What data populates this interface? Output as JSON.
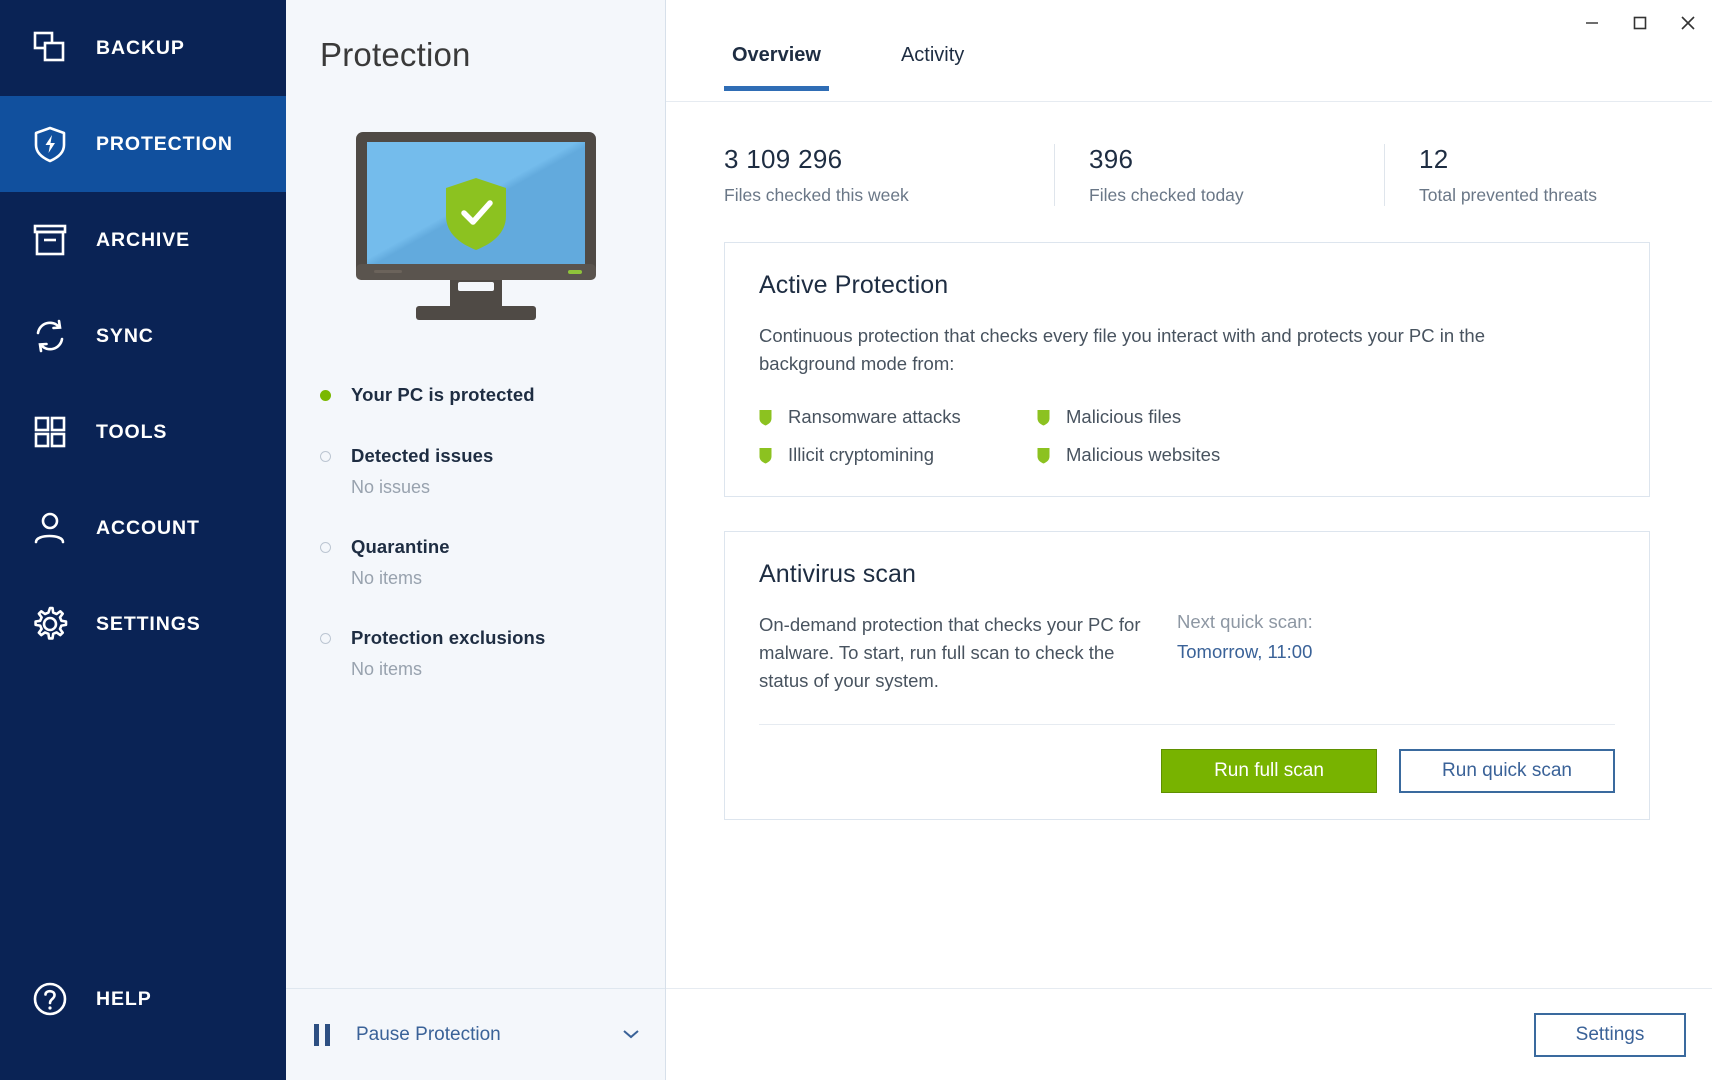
{
  "sidebar": {
    "items": [
      {
        "label": "BACKUP",
        "icon": "copy-icon",
        "active": false
      },
      {
        "label": "PROTECTION",
        "icon": "shield-bolt-icon",
        "active": true
      },
      {
        "label": "ARCHIVE",
        "icon": "archive-box-icon",
        "active": false
      },
      {
        "label": "SYNC",
        "icon": "sync-refresh-icon",
        "active": false
      },
      {
        "label": "TOOLS",
        "icon": "grid-squares-icon",
        "active": false
      },
      {
        "label": "ACCOUNT",
        "icon": "person-icon",
        "active": false
      },
      {
        "label": "SETTINGS",
        "icon": "gear-icon",
        "active": false
      }
    ],
    "help": {
      "label": "HELP",
      "icon": "question-circle-icon"
    }
  },
  "middle": {
    "title": "Protection",
    "illustration": "monitor-with-green-shield-check",
    "status_items": [
      {
        "main": "Your PC is protected",
        "sub": "",
        "dot": "green"
      },
      {
        "main": "Detected issues",
        "sub": "No issues",
        "dot": "hollow"
      },
      {
        "main": "Quarantine",
        "sub": "No items",
        "dot": "hollow"
      },
      {
        "main": "Protection exclusions",
        "sub": "No items",
        "dot": "hollow"
      }
    ],
    "pause": {
      "label": "Pause Protection",
      "icon": "pause-icon",
      "chevron": "⌄"
    }
  },
  "window_controls": {
    "minimize": "minimize-icon",
    "maximize": "maximize-icon",
    "close": "close-icon"
  },
  "tabs": [
    {
      "label": "Overview",
      "active": true
    },
    {
      "label": "Activity",
      "active": false
    }
  ],
  "stats": [
    {
      "value": "3 109 296",
      "label": "Files checked this week"
    },
    {
      "value": "396",
      "label": "Files checked today"
    },
    {
      "value": "12",
      "label": "Total prevented threats"
    }
  ],
  "active_protection": {
    "title": "Active Protection",
    "description": "Continuous protection that checks every file you interact with and protects your PC in the background mode from:",
    "bullets": [
      "Ransomware attacks",
      "Malicious files",
      "Illicit cryptomining",
      "Malicious websites"
    ]
  },
  "antivirus_scan": {
    "title": "Antivirus scan",
    "description": "On-demand protection that checks your PC for malware. To start, run full scan to check the status of your system.",
    "next_scan_label": "Next quick scan:",
    "next_scan_value": "Tomorrow, 11:00",
    "run_full_label": "Run full scan",
    "run_quick_label": "Run quick scan"
  },
  "footer": {
    "settings_label": "Settings"
  },
  "colors": {
    "sidebar_bg": "#0a2355",
    "sidebar_active": "#11509e",
    "accent_blue": "#2f6db5",
    "link_blue": "#3a6298",
    "green": "#78b300",
    "status_green": "#7ab800"
  }
}
